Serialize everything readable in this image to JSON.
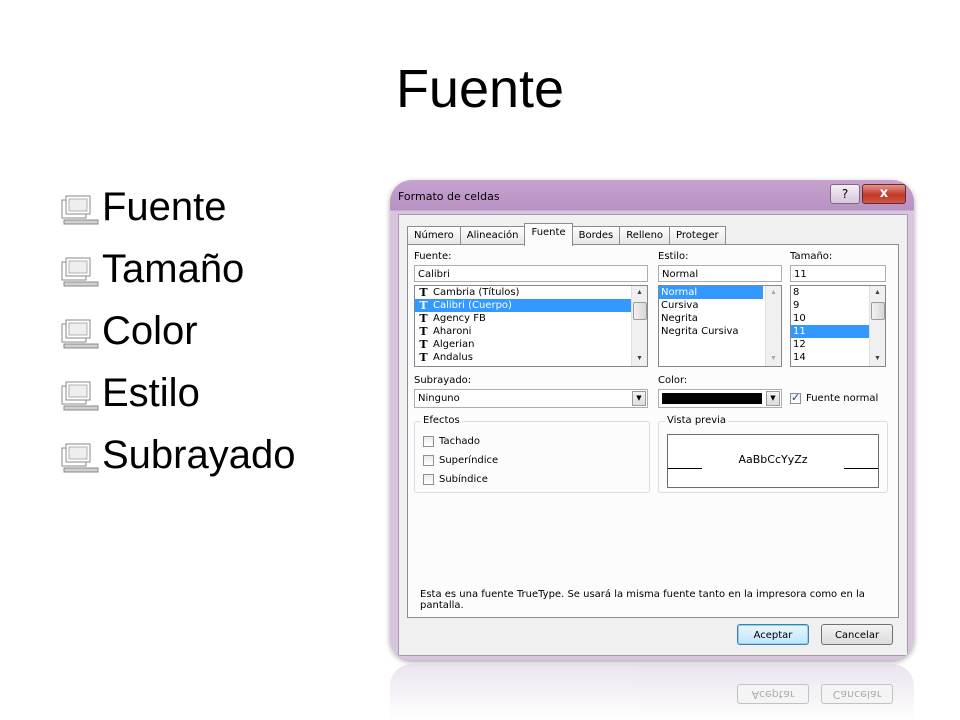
{
  "slide": {
    "title": "Fuente",
    "bullets": [
      "Fuente",
      "Tamaño",
      "Color",
      "Estilo",
      "Subrayado"
    ]
  },
  "dialog": {
    "title": "Formato de celdas",
    "help_label": "?",
    "close_label": "x",
    "tabs": [
      "Número",
      "Alineación",
      "Fuente",
      "Bordes",
      "Relleno",
      "Proteger"
    ],
    "active_tab": "Fuente",
    "font": {
      "label": "Fuente:",
      "value": "Calibri",
      "items": [
        "Cambria (Títulos)",
        "Calibri (Cuerpo)",
        "Agency FB",
        "Aharoni",
        "Algerian",
        "Andalus"
      ],
      "selected": "Calibri (Cuerpo)",
      "item_icon": "truetype-icon"
    },
    "style": {
      "label": "Estilo:",
      "value": "Normal",
      "items": [
        "Normal",
        "Cursiva",
        "Negrita",
        "Negrita Cursiva"
      ],
      "selected": "Normal"
    },
    "size": {
      "label": "Tamaño:",
      "value": "11",
      "items": [
        "8",
        "9",
        "10",
        "11",
        "12",
        "14"
      ],
      "selected": "11"
    },
    "underline": {
      "label": "Subrayado:",
      "value": "Ninguno"
    },
    "color": {
      "label": "Color:",
      "value": "#000000"
    },
    "normal_font": {
      "label": "Fuente normal",
      "checked": true
    },
    "effects": {
      "title": "Efectos",
      "items": [
        {
          "label": "Tachado",
          "checked": false
        },
        {
          "label": "Superíndice",
          "checked": false
        },
        {
          "label": "Subíndice",
          "checked": false
        }
      ]
    },
    "preview": {
      "title": "Vista previa",
      "sample": "AaBbCcYyZz"
    },
    "info_text": "Esta es una fuente TrueType. Se usará la misma fuente tanto en la impresora como en la pantalla.",
    "ok_label": "Aceptar",
    "cancel_label": "Cancelar"
  }
}
